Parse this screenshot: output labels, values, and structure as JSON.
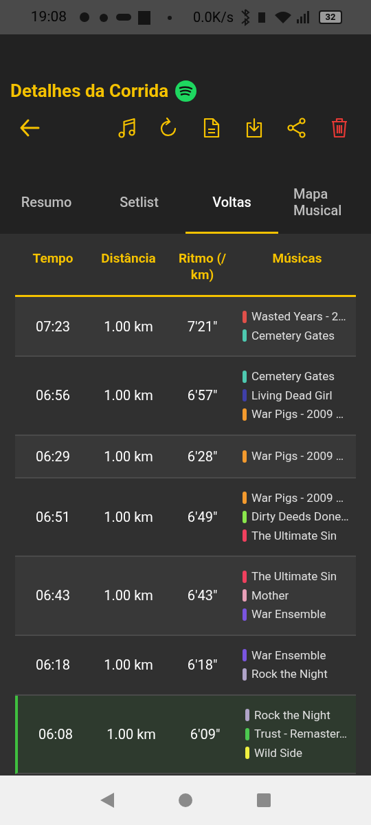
{
  "status_bar": {
    "time": "19:08",
    "speed": "0.0K/s",
    "battery": "32"
  },
  "title": "Detalhes da Corrida",
  "tabs": [
    {
      "label": "Resumo",
      "selected": false
    },
    {
      "label": "Setlist",
      "selected": false
    },
    {
      "label": "Voltas",
      "selected": true
    },
    {
      "label": "Mapa Musical",
      "selected": false
    }
  ],
  "table": {
    "columns": [
      "Tempo",
      "Distância",
      "Ritmo (/ km)",
      "Músicas"
    ],
    "rows": [
      {
        "selected": false,
        "time": "07:23",
        "distance": "1.00 km",
        "pace": "7'21\"",
        "songs": [
          {
            "title": "Wasted Years - 2…",
            "color": "#e0504a"
          },
          {
            "title": "Cemetery Gates",
            "color": "#4ec9b0"
          }
        ]
      },
      {
        "selected": false,
        "time": "06:56",
        "distance": "1.00 km",
        "pace": "6'57\"",
        "songs": [
          {
            "title": "Cemetery Gates",
            "color": "#4ec9b0"
          },
          {
            "title": "Living Dead Girl",
            "color": "#3f3fa8"
          },
          {
            "title": "War Pigs - 2009 …",
            "color": "#f39a2e"
          }
        ]
      },
      {
        "selected": false,
        "time": "06:29",
        "distance": "1.00 km",
        "pace": "6'28\"",
        "songs": [
          {
            "title": "War Pigs - 2009 …",
            "color": "#f39a2e"
          }
        ]
      },
      {
        "selected": false,
        "time": "06:51",
        "distance": "1.00 km",
        "pace": "6'49\"",
        "songs": [
          {
            "title": "War Pigs - 2009 …",
            "color": "#f39a2e"
          },
          {
            "title": "Dirty Deeds Done…",
            "color": "#8ae64c"
          },
          {
            "title": "The Ultimate Sin",
            "color": "#f0405e"
          }
        ]
      },
      {
        "selected": false,
        "time": "06:43",
        "distance": "1.00 km",
        "pace": "6'43\"",
        "songs": [
          {
            "title": "The Ultimate Sin",
            "color": "#f0405e"
          },
          {
            "title": "Mother",
            "color": "#e8a0b8"
          },
          {
            "title": "War Ensemble",
            "color": "#7a55e0"
          }
        ]
      },
      {
        "selected": false,
        "time": "06:18",
        "distance": "1.00 km",
        "pace": "6'18\"",
        "songs": [
          {
            "title": "War Ensemble",
            "color": "#7a55e0"
          },
          {
            "title": "Rock the Night",
            "color": "#b0a4c8"
          }
        ]
      },
      {
        "selected": true,
        "time": "06:08",
        "distance": "1.00 km",
        "pace": "6'09\"",
        "songs": [
          {
            "title": "Rock the Night",
            "color": "#b0a4c8"
          },
          {
            "title": "Trust - Remaster…",
            "color": "#4cc850"
          },
          {
            "title": "Wild Side",
            "color": "#f0f040"
          }
        ]
      }
    ]
  }
}
